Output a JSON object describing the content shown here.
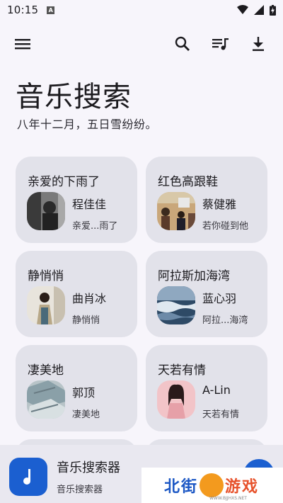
{
  "status_bar": {
    "time": "10:15",
    "notification_letter": "A"
  },
  "toolbar": {
    "menu_icon": "menu-icon",
    "search_icon": "search-icon",
    "queue_icon": "playlist-music-icon",
    "download_icon": "download-icon"
  },
  "header": {
    "title": "音乐搜索",
    "subtitle": "八年十二月，五日雪纷纷。"
  },
  "cards": [
    {
      "title": "亲爱的下雨了",
      "artist": "程佳佳",
      "album": "亲爱...雨了"
    },
    {
      "title": "红色高跟鞋",
      "artist": "蔡健雅",
      "album": "若你碰到他"
    },
    {
      "title": "静悄悄",
      "artist": "曲肖冰",
      "album": "静悄悄"
    },
    {
      "title": "阿拉斯加海湾",
      "artist": "蓝心羽",
      "album": "阿拉...海湾"
    },
    {
      "title": "凄美地",
      "artist": "郭顶",
      "album": "凄美地"
    },
    {
      "title": "天若有情",
      "artist": "A-Lin",
      "album": "天若有情"
    }
  ],
  "player": {
    "title": "音乐搜索器",
    "subtitle": "音乐搜索器",
    "accent_color": "#1b5fd0"
  },
  "watermark": {
    "text_left": "北街",
    "text_right": "游戏",
    "url": "WWW.BJJHXS.NET"
  }
}
